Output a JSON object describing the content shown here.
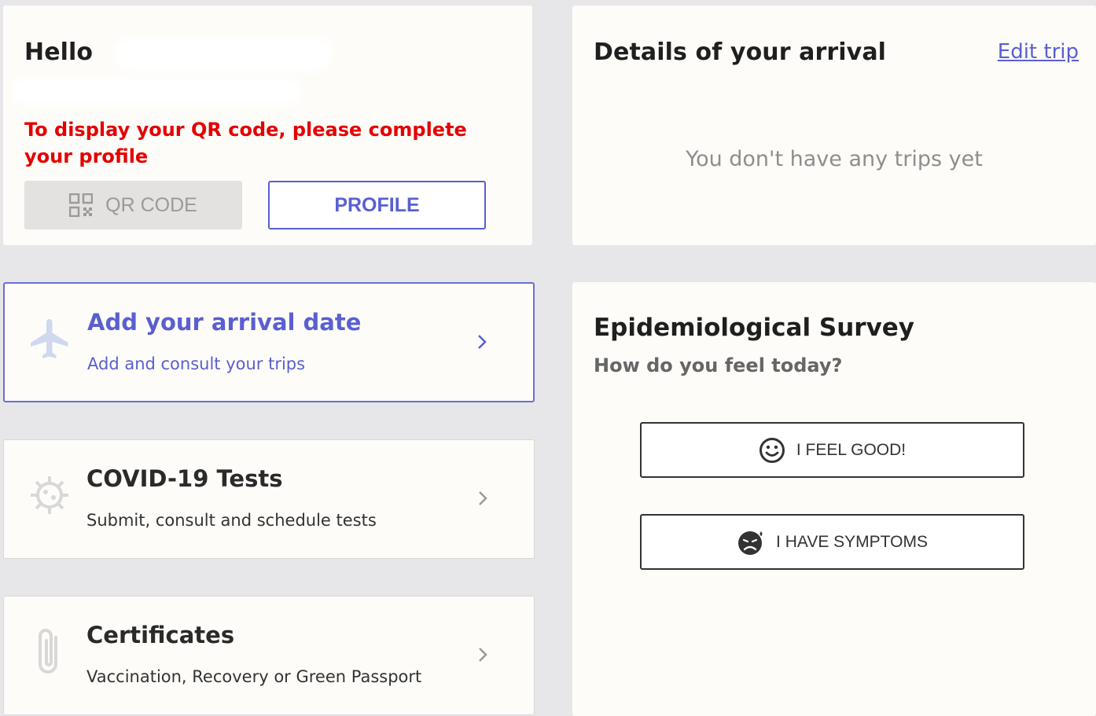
{
  "hello": {
    "greeting": "Hello",
    "warning": "To display your QR code, please complete your profile",
    "qr_button": "QR CODE",
    "profile_button": "PROFILE"
  },
  "arrival": {
    "title": "Details of your arrival",
    "edit_link": "Edit trip",
    "empty_message": "You don't have any trips yet"
  },
  "nav_cards": [
    {
      "title": "Add your arrival date",
      "subtitle": "Add and consult your trips",
      "icon": "airplane-icon"
    },
    {
      "title": "COVID-19 Tests",
      "subtitle": "Submit, consult and schedule tests",
      "icon": "virus-icon"
    },
    {
      "title": "Certificates",
      "subtitle": "Vaccination, Recovery or Green Passport",
      "icon": "paperclip-icon"
    }
  ],
  "survey": {
    "title": "Epidemiological Survey",
    "question": "How do you feel today?",
    "good_button": "I FEEL GOOD!",
    "symptoms_button": "I HAVE SYMPTOMS"
  },
  "colors": {
    "accent": "#5a5fd0",
    "warning": "#e40000",
    "background": "#e7e6e8",
    "card": "#fdfcf8"
  }
}
